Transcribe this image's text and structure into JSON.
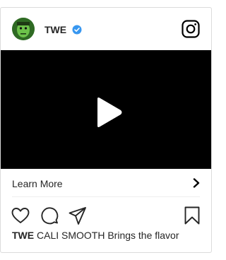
{
  "post": {
    "username": "TWE",
    "verified": true,
    "cta_label": "Learn More",
    "caption_user": "TWE",
    "caption_text": "CALI SMOOTH Brings the flavor"
  },
  "colors": {
    "verified_blue": "#3897f0",
    "avatar_green": "#3f8f2f",
    "text": "#262626",
    "border": "#dbdbdb"
  },
  "icons": {
    "brand": "instagram-icon",
    "play": "play-icon",
    "cta_arrow": "chevron-right-icon",
    "like": "heart-icon",
    "comment": "comment-icon",
    "share": "share-icon",
    "save": "bookmark-icon"
  }
}
